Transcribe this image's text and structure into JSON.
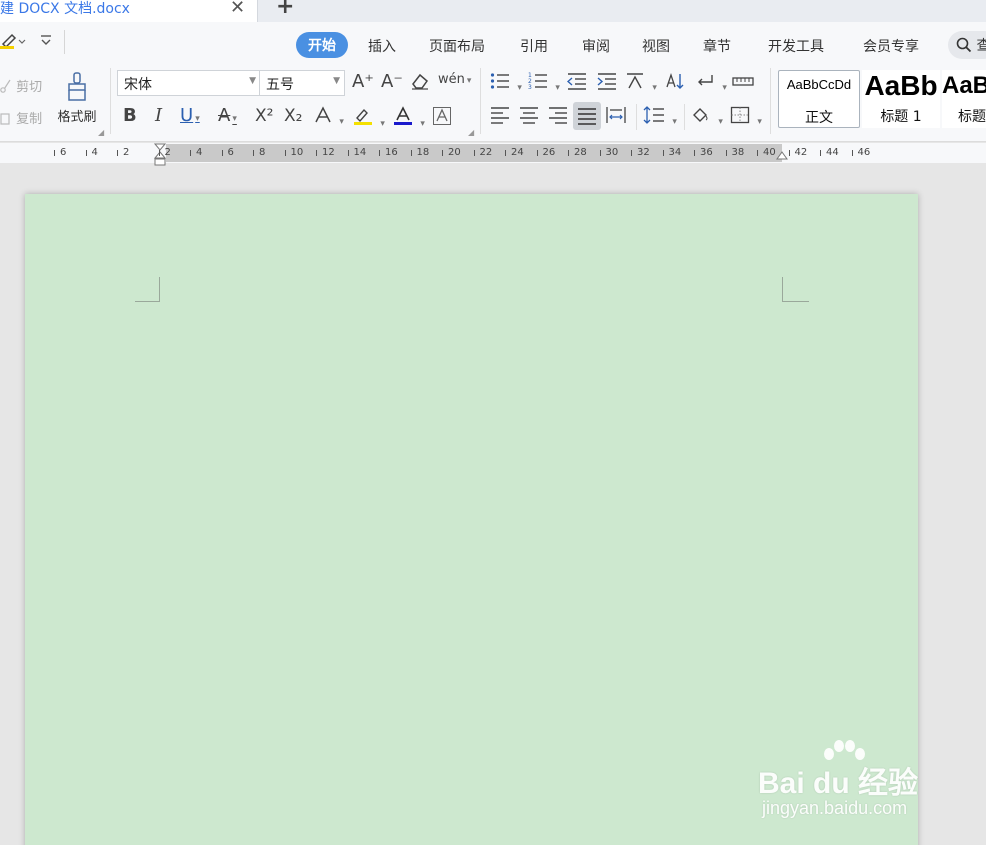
{
  "tab": {
    "title": "建 DOCX 文档.docx",
    "close_glyph": "✕",
    "new_glyph": "+"
  },
  "menu": {
    "items": [
      {
        "label": "开始",
        "active": true
      },
      {
        "label": "插入"
      },
      {
        "label": "页面布局"
      },
      {
        "label": "引用"
      },
      {
        "label": "审阅"
      },
      {
        "label": "视图"
      },
      {
        "label": "章节"
      },
      {
        "label": "开发工具"
      },
      {
        "label": "会员专享"
      }
    ],
    "search_label": "查"
  },
  "clipboard": {
    "cut_label": "剪切",
    "copy_label": "复制",
    "format_painter_label": "格式刷"
  },
  "font": {
    "family_value": "宋体",
    "size_value": "五号",
    "bold": "B",
    "italic": "I",
    "underline": "U",
    "strike": "A",
    "superscript": "X²",
    "subscript": "X₂",
    "grow": "A⁺",
    "shrink": "A⁻",
    "phonetic": "wén"
  },
  "styles": [
    {
      "sample": "AaBbCcDd",
      "name": "正文"
    },
    {
      "sample": "AaBb",
      "name": "标题 1"
    },
    {
      "sample": "AaB",
      "name": "标题"
    }
  ],
  "ruler": {
    "labels": [
      "6",
      "4",
      "2",
      "2",
      "4",
      "6",
      "8",
      "10",
      "12",
      "14",
      "16",
      "18",
      "20",
      "22",
      "24",
      "26",
      "28",
      "30",
      "32",
      "34",
      "36",
      "38",
      "40",
      "42",
      "44",
      "46"
    ]
  },
  "watermark": {
    "brand": "Bai du 经验",
    "url": "jingyan.baidu.com"
  },
  "colors": {
    "accent": "#4a90e2",
    "page_bg": "#cde8cf",
    "tab_title": "#3b78e7"
  }
}
